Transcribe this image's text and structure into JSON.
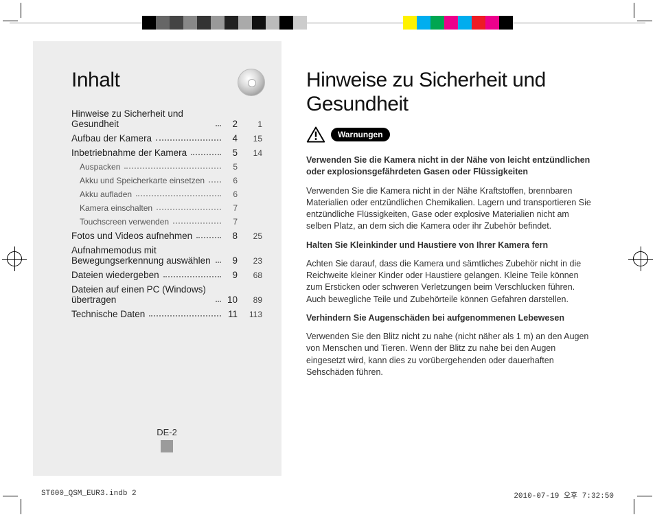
{
  "toc_title": "Inhalt",
  "right_title": "Hinweise zu Sicherheit und Gesundheit",
  "warn_label": "Warnungen",
  "toc": [
    {
      "label": "Hinweise zu Sicherheit und Gesundheit",
      "page": "2",
      "ext": "1"
    },
    {
      "label": "Aufbau der Kamera",
      "page": "4",
      "ext": "15"
    },
    {
      "label": "Inbetriebnahme der Kamera",
      "page": "5",
      "ext": "14"
    },
    {
      "label": "Auspacken",
      "page": "5",
      "sub": true
    },
    {
      "label": "Akku und Speicherkarte einsetzen",
      "page": "6",
      "sub": true
    },
    {
      "label": "Akku aufladen",
      "page": "6",
      "sub": true
    },
    {
      "label": "Kamera einschalten",
      "page": "7",
      "sub": true
    },
    {
      "label": "Touchscreen verwenden",
      "page": "7",
      "sub": true
    },
    {
      "label": "Fotos und Videos aufnehmen",
      "page": "8",
      "ext": "25"
    },
    {
      "label": "Aufnahmemodus mit Bewegungserkennung auswählen",
      "page": "9",
      "ext": "23"
    },
    {
      "label": "Dateien wiedergeben",
      "page": "9",
      "ext": "68"
    },
    {
      "label": "Dateien auf einen PC (Windows) übertragen",
      "page": "10",
      "ext": "89"
    },
    {
      "label": "Technische Daten",
      "page": "11",
      "ext": "113"
    }
  ],
  "page_number": "DE-2",
  "body": {
    "h1": "Verwenden Sie die Kamera nicht in der Nähe von leicht entzündlichen oder explosionsgefährdeten Gasen oder Flüssigkeiten",
    "p1": "Verwenden Sie die Kamera nicht in der Nähe Kraftstoffen, brennbaren Materialien oder entzündlichen Chemikalien. Lagern und transportieren Sie entzündliche Flüssigkeiten, Gase oder explosive Materialien nicht am selben Platz, an dem sich die Kamera oder ihr Zubehör befindet.",
    "h2": "Halten Sie Kleinkinder und Haustiere von Ihrer Kamera fern",
    "p2": "Achten Sie darauf, dass die Kamera und sämtliches Zubehör nicht in die Reichweite kleiner Kinder oder Haustiere gelangen. Kleine Teile können zum Ersticken oder schweren Verletzungen beim Verschlucken führen. Auch bewegliche Teile und Zubehörteile können Gefahren darstellen.",
    "h3": "Verhindern Sie Augenschäden bei aufgenommenen Lebewesen",
    "p3": "Verwenden Sie den Blitz nicht zu nahe (nicht näher als 1 m) an den Augen von Menschen und Tieren. Wenn der Blitz zu nahe bei den Augen eingesetzt wird, kann dies zu vorübergehenden oder dauerhaften Sehschäden führen."
  },
  "footer_left": "ST600_QSM_EUR3.indb   2",
  "footer_right": "2010-07-19   오후 7:32:50",
  "swatches_left": [
    "#000",
    "#666",
    "#444",
    "#888",
    "#333",
    "#999",
    "#222",
    "#aaa",
    "#111",
    "#bbb",
    "#000",
    "#ccc"
  ],
  "swatches_right": [
    "#fff200",
    "#00aeef",
    "#00a651",
    "#ec008c",
    "#00adee",
    "#ed1c24",
    "#ec008c",
    "#000"
  ]
}
